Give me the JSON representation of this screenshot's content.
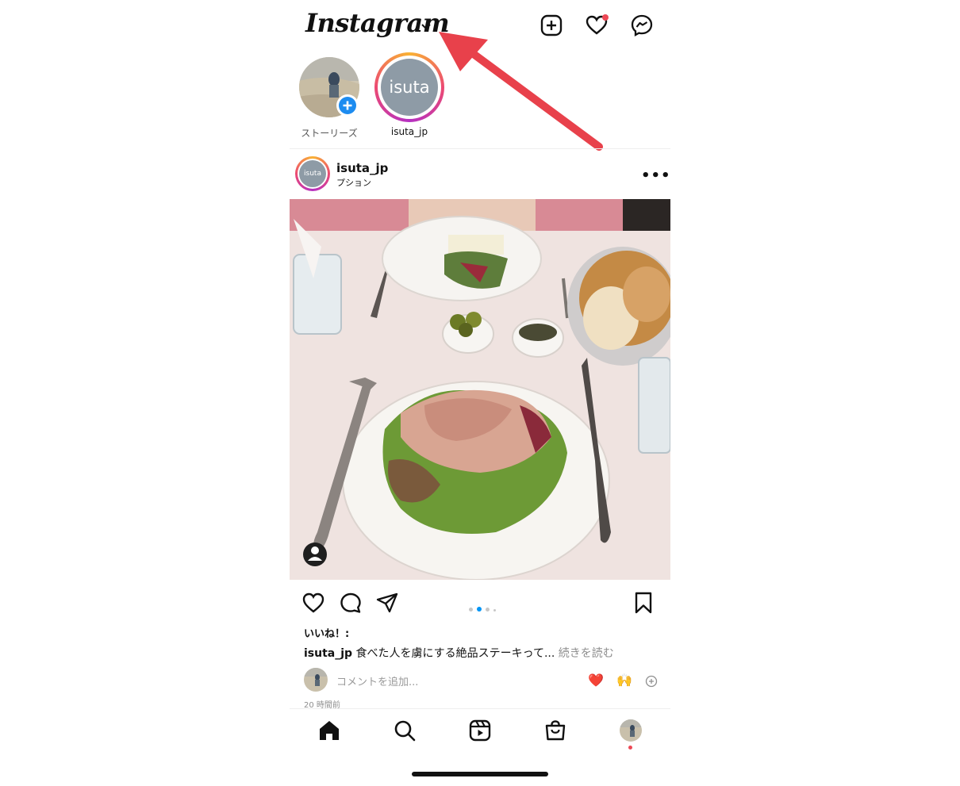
{
  "header": {
    "logo_text": "Instagram",
    "icons": [
      "add-post-icon",
      "heart-icon",
      "messenger-icon"
    ]
  },
  "stories": [
    {
      "label": "ストーリーズ",
      "type": "own-story"
    },
    {
      "label": "isuta_jp",
      "avatar_text": "isuta"
    }
  ],
  "post": {
    "username": "isuta_jp",
    "subtitle": "プション",
    "avatar_text": "isuta",
    "more_label": "•••",
    "likes_label": "いいね！:",
    "caption_user": "isuta_jp",
    "caption_text": "食べた人を虜にする絶品ステーキって...",
    "caption_more": "続きを読む",
    "comment_placeholder": "コメントを追加...",
    "comment_emojis": [
      "❤️",
      "🙌"
    ],
    "timestamp": "20 時間前",
    "carousel_total": 4,
    "carousel_active_index": 1
  },
  "nav": {
    "items": [
      "home-icon",
      "search-icon",
      "reels-icon",
      "shop-icon",
      "profile-avatar"
    ]
  },
  "colors": {
    "accent_red": "#ed4956",
    "blue": "#0095f6",
    "arrow_red": "#e8414b"
  }
}
